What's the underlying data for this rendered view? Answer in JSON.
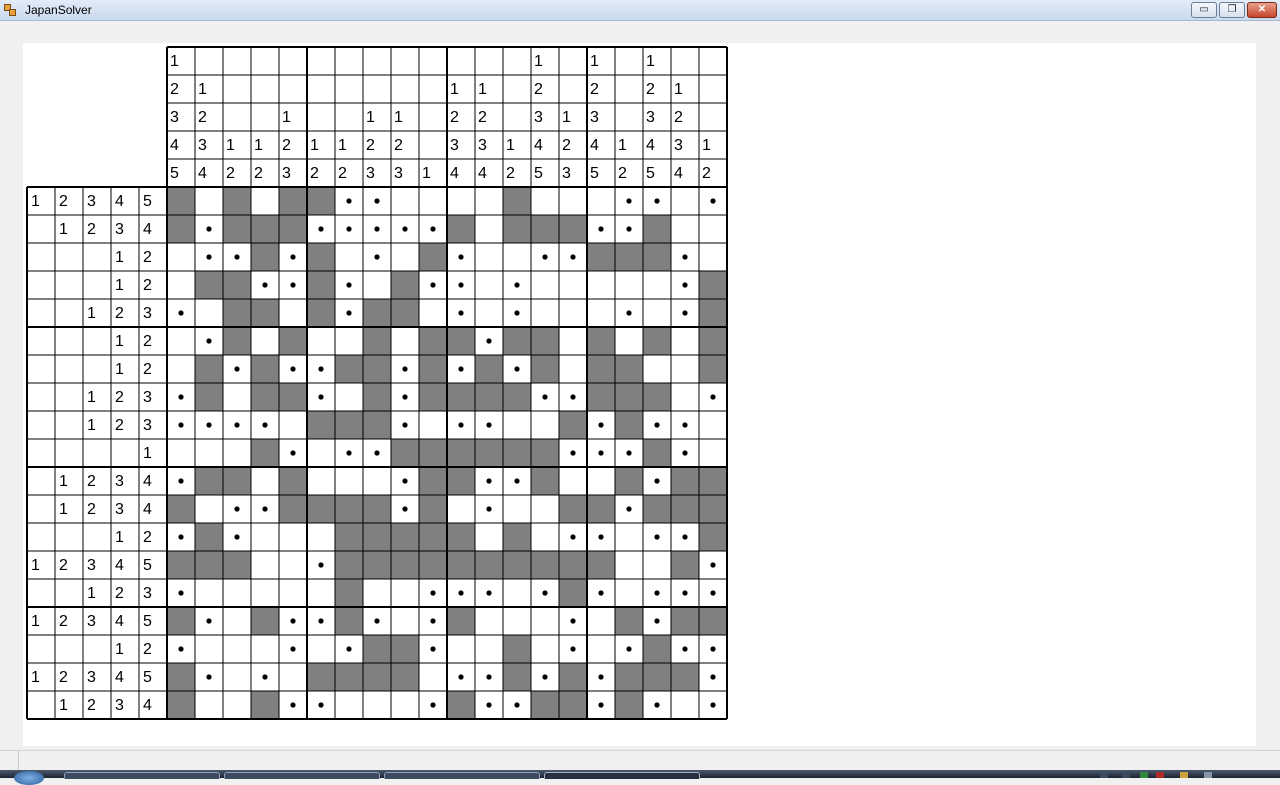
{
  "window": {
    "title": "JapanSolver",
    "minimize_glyph": "▭",
    "maximize_glyph": "❐",
    "close_glyph": "✕",
    "icon": "app-icon"
  },
  "colors": {
    "filled": "#808080",
    "empty": "#ffffff",
    "dot": "#000000",
    "grid_line": "#000000",
    "canvas": "#ffffff"
  },
  "puzzle": {
    "rows": 19,
    "cols": 20,
    "column_clues": [
      [
        "1",
        "2",
        "3",
        "4",
        "5"
      ],
      [
        "",
        "1",
        "2",
        "3",
        "4"
      ],
      [
        "",
        "",
        "",
        "1",
        "2"
      ],
      [
        "",
        "",
        "",
        "1",
        "2"
      ],
      [
        "",
        "",
        "1",
        "2",
        "3"
      ],
      [
        "",
        "",
        "",
        "1",
        "2"
      ],
      [
        "",
        "",
        "",
        "1",
        "2"
      ],
      [
        "",
        "",
        "1",
        "2",
        "3"
      ],
      [
        "",
        "",
        "1",
        "2",
        "3"
      ],
      [
        "",
        "",
        "",
        "",
        "1"
      ],
      [
        "",
        "1",
        "2",
        "3",
        "4"
      ],
      [
        "",
        "1",
        "2",
        "3",
        "4"
      ],
      [
        "",
        "",
        "",
        "1",
        "2"
      ],
      [
        "1",
        "2",
        "3",
        "4",
        "5"
      ],
      [
        "",
        "",
        "1",
        "2",
        "3"
      ],
      [
        "1",
        "2",
        "3",
        "4",
        "5"
      ],
      [
        "",
        "",
        "",
        "1",
        "2"
      ],
      [
        "1",
        "2",
        "3",
        "4",
        "5"
      ],
      [
        "",
        "1",
        "2",
        "3",
        "4"
      ],
      [
        "",
        "",
        "",
        "1",
        "2"
      ]
    ],
    "row_clues": [
      [
        "1",
        "2",
        "3",
        "4",
        "5"
      ],
      [
        "",
        "1",
        "2",
        "3",
        "4"
      ],
      [
        "",
        "",
        "",
        "1",
        "2"
      ],
      [
        "",
        "",
        "",
        "1",
        "2"
      ],
      [
        "",
        "",
        "1",
        "2",
        "3"
      ],
      [
        "",
        "",
        "",
        "1",
        "2"
      ],
      [
        "",
        "",
        "",
        "1",
        "2"
      ],
      [
        "",
        "",
        "1",
        "2",
        "3"
      ],
      [
        "",
        "",
        "1",
        "2",
        "3"
      ],
      [
        "",
        "",
        "",
        "",
        "1"
      ],
      [
        "",
        "1",
        "2",
        "3",
        "4"
      ],
      [
        "",
        "1",
        "2",
        "3",
        "4"
      ],
      [
        "",
        "",
        "",
        "1",
        "2"
      ],
      [
        "1",
        "2",
        "3",
        "4",
        "5"
      ],
      [
        "",
        "",
        "1",
        "2",
        "3"
      ],
      [
        "1",
        "2",
        "3",
        "4",
        "5"
      ],
      [
        "",
        "",
        "",
        "1",
        "2"
      ],
      [
        "1",
        "2",
        "3",
        "4",
        "5"
      ],
      [
        "",
        "1",
        "2",
        "3",
        "4"
      ]
    ],
    "cells": [
      "#.#.##**....#...**.*.#",
      "#*###*****#.###**#..*",
      ".**#*#.*.#*..**###*.*",
      ".##**#*.#**.*.....*#*",
      "*.##.#*##.*.*...*.*#",
      ".*#.#..#.##*##.#.#.#",
      ".#*#**##*#*#*#.##..#",
      "*#.##*.#*####**###.*",
      "****.###*.**..#*#**",
      "...#*.**######***#*..#",
      "*##.#...*##**#..#*##",
      "#.**####*#.*..##*###.",
      "*#*...#####.#.**.**#*",
      "###..*##########..#*#*",
      "*.....#..***.*#*.***",
      "#*.#**#*.*#...*.#*##",
      "*...*.*##*..#.*.*#**",
      "#*.*.####.**#*#*###*",
      "#..#**...*#**##*#*.*"
    ]
  }
}
